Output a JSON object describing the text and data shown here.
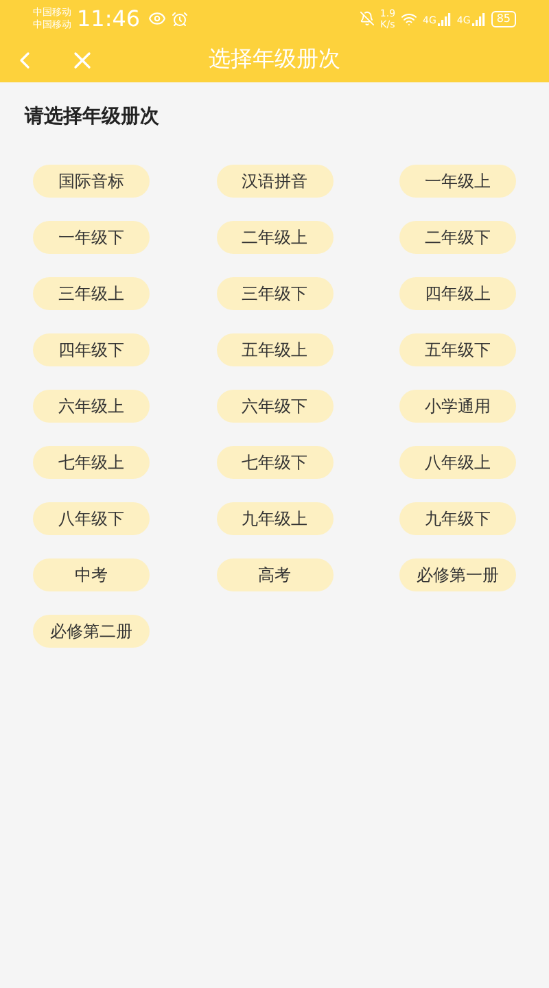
{
  "status_bar": {
    "carriers": [
      "中国移动",
      "中国移动"
    ],
    "time": "11:46",
    "speed_value": "1.9",
    "speed_unit": "K/s",
    "networks": [
      "4G",
      "4G"
    ],
    "battery": "85"
  },
  "header": {
    "title": "选择年级册次"
  },
  "prompt": "请选择年级册次",
  "grades": [
    "国际音标",
    "汉语拼音",
    "一年级上",
    "一年级下",
    "二年级上",
    "二年级下",
    "三年级上",
    "三年级下",
    "四年级上",
    "四年级下",
    "五年级上",
    "五年级下",
    "六年级上",
    "六年级下",
    "小学通用",
    "七年级上",
    "七年级下",
    "八年级上",
    "八年级下",
    "九年级上",
    "九年级下",
    "中考",
    "高考",
    "必修第一册",
    "必修第二册"
  ]
}
